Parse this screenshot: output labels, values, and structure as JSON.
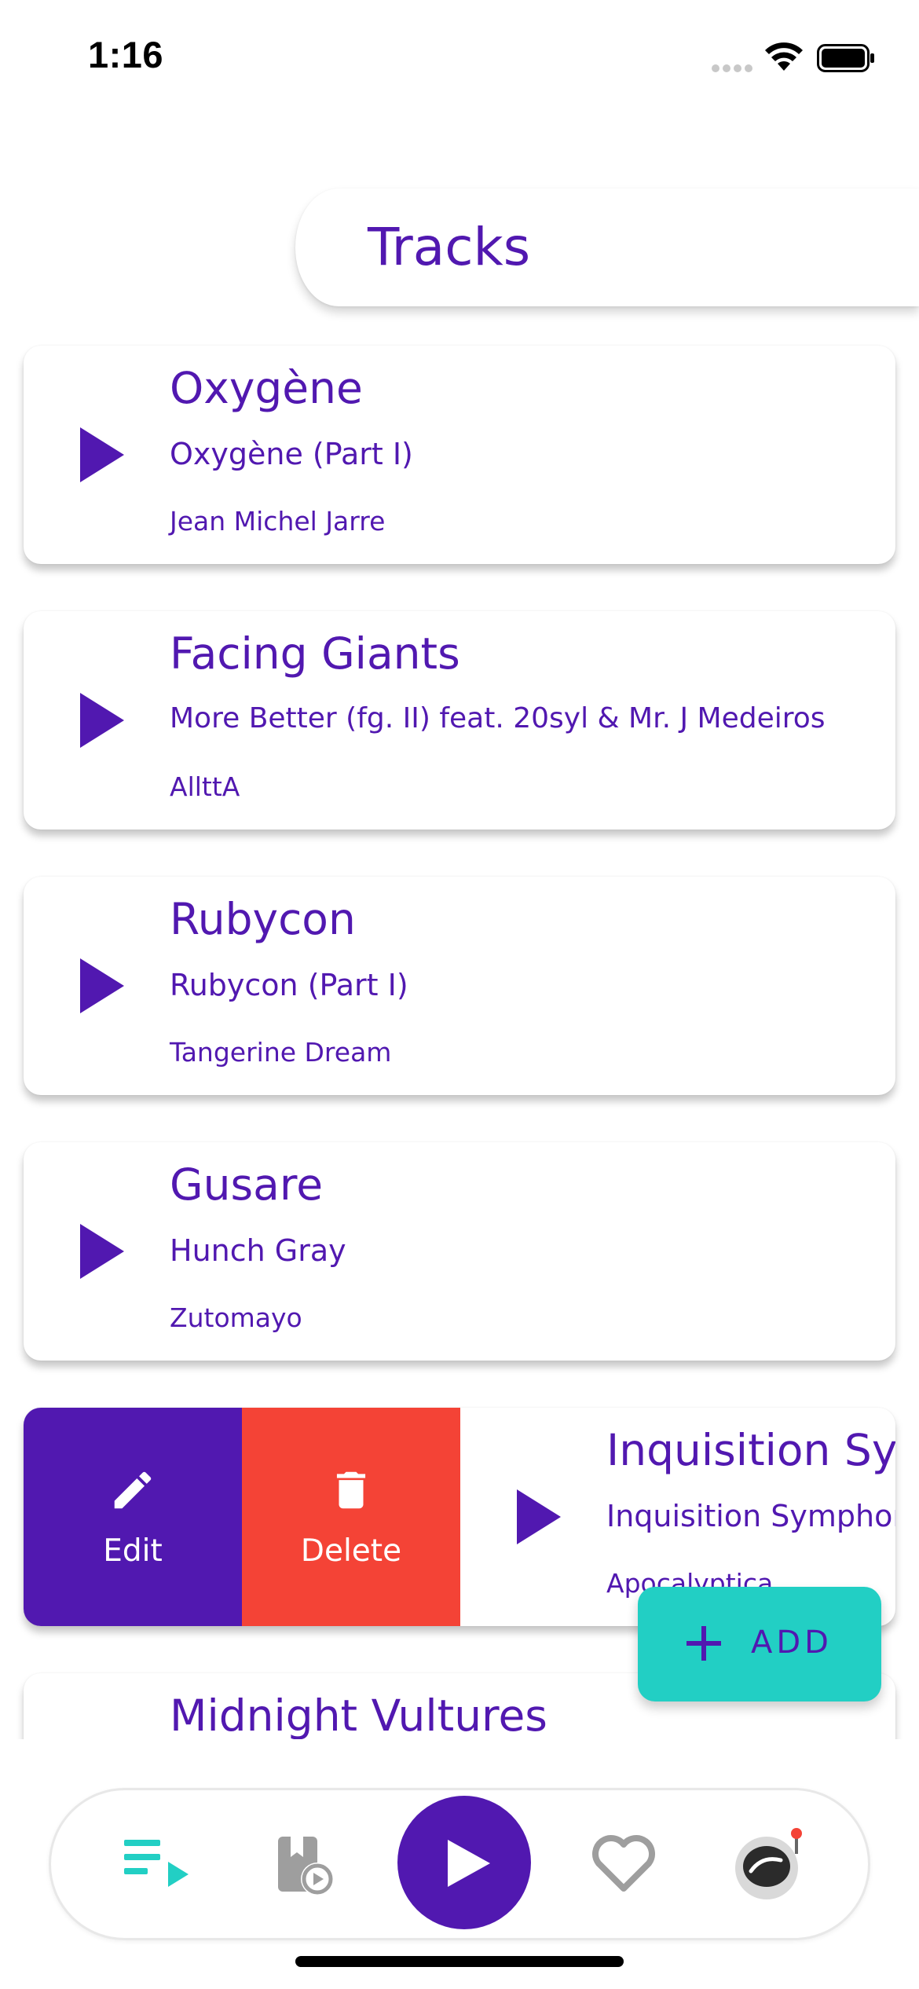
{
  "status_bar": {
    "time": "1:16"
  },
  "header": {
    "title": "Tracks"
  },
  "tracks": [
    {
      "title": "Oxygène",
      "album": "Oxygène (Part I)",
      "artist": "Jean Michel Jarre"
    },
    {
      "title": "Facing Giants",
      "album": "More Better  (fg. II) feat. 20syl & Mr. J Medeiros",
      "artist": "AllttA"
    },
    {
      "title": "Rubycon",
      "album": "Rubycon (Part I)",
      "artist": "Tangerine Dream"
    },
    {
      "title": "Gusare",
      "album": "Hunch Gray",
      "artist": "Zutomayo"
    },
    {
      "title": "Inquisition Symphony",
      "album": "Inquisition Symphony",
      "artist": "Apocalyptica"
    },
    {
      "title": "Midnight Vultures",
      "album": "",
      "artist": ""
    }
  ],
  "swipe_actions": {
    "edit_label": "Edit",
    "delete_label": "Delete"
  },
  "fab": {
    "label": "ADD"
  },
  "bottom_nav": {
    "items": [
      "queue-icon",
      "playlist-icon",
      "play-icon",
      "favorite-icon",
      "astronaut-icon"
    ],
    "active": "queue-icon"
  },
  "colors": {
    "primary": "#5118b0",
    "accent": "#22cfc4",
    "danger": "#f44336"
  }
}
